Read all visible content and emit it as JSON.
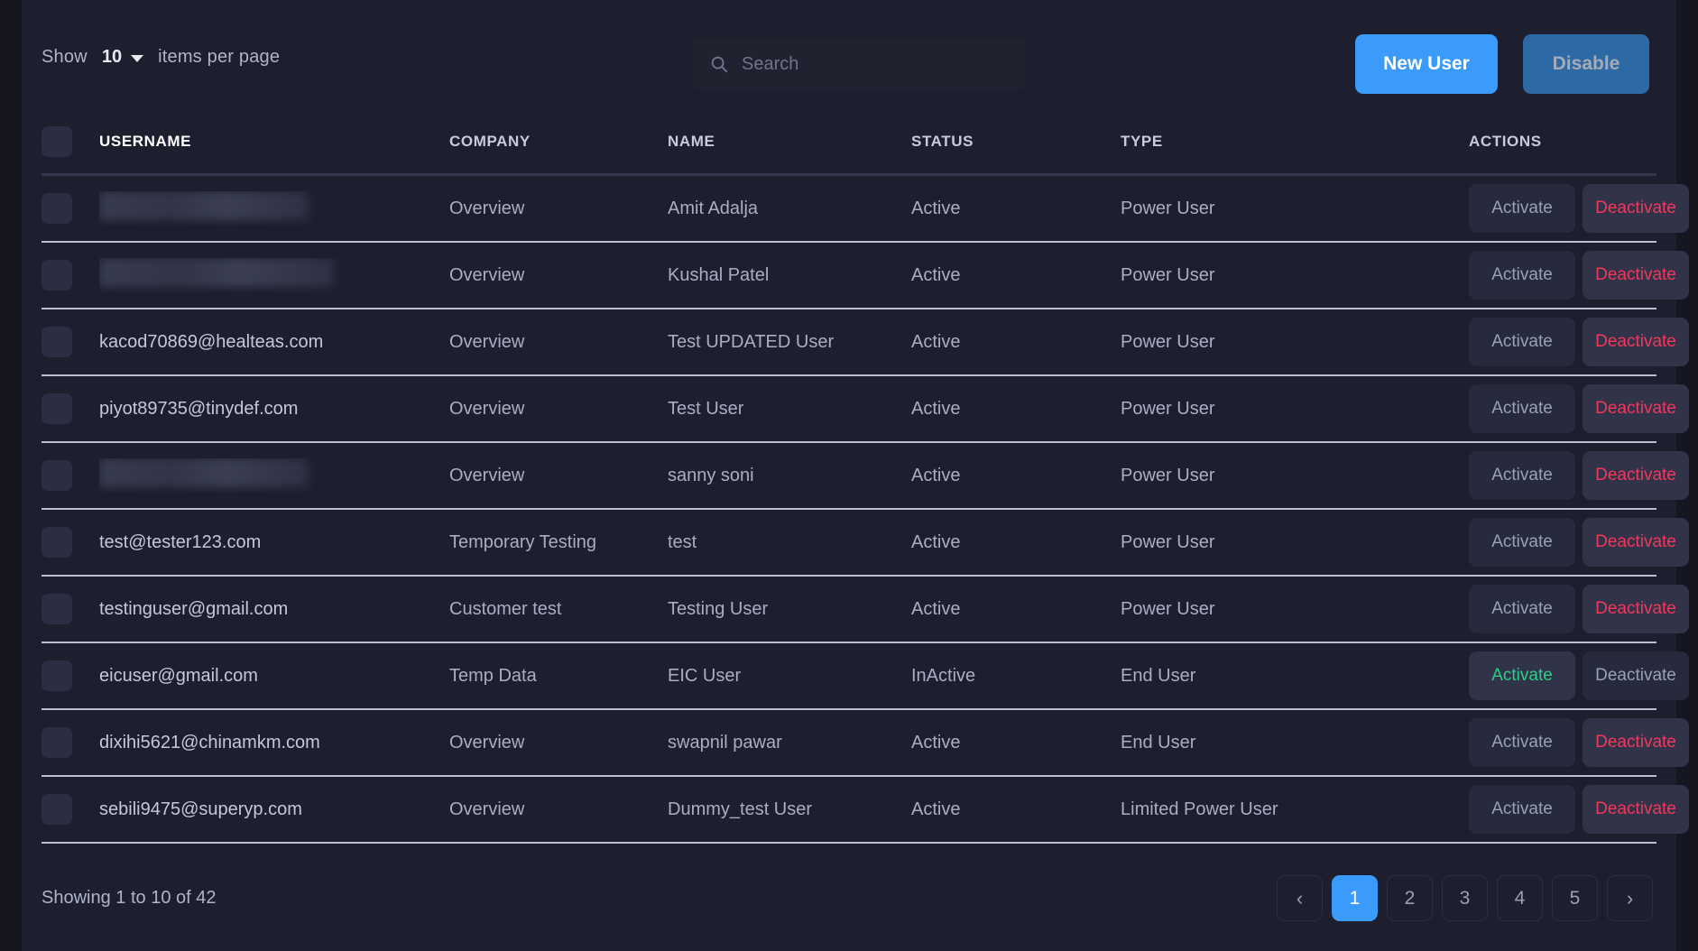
{
  "toolbar": {
    "show_label": "Show",
    "page_size_value": "10",
    "per_page_label": "items per page",
    "search_placeholder": "Search",
    "search_value": "",
    "new_user_label": "New User",
    "disable_label": "Disable",
    "accent_color": "#3b9bfa",
    "disable_color": "#2c69a5"
  },
  "table": {
    "columns": [
      "USERNAME",
      "COMPANY",
      "NAME",
      "STATUS",
      "TYPE",
      "ACTIONS"
    ],
    "activate_label": "Activate",
    "deactivate_label": "Deactivate",
    "danger_color": "#f5365c",
    "success_color": "#2dce89",
    "rows": [
      {
        "username": "",
        "redacted": true,
        "redacted_width": 232,
        "company": "Overview",
        "name": "Amit Adalja",
        "status": "Active",
        "type": "Power User",
        "active_state": true
      },
      {
        "username": "",
        "redacted": true,
        "redacted_width": 260,
        "company": "Overview",
        "name": "Kushal Patel",
        "status": "Active",
        "type": "Power User",
        "active_state": true
      },
      {
        "username": "kacod70869@healteas.com",
        "redacted": false,
        "company": "Overview",
        "name": "Test UPDATED User",
        "status": "Active",
        "type": "Power User",
        "active_state": true
      },
      {
        "username": "piyot89735@tinydef.com",
        "redacted": false,
        "company": "Overview",
        "name": "Test User",
        "status": "Active",
        "type": "Power User",
        "active_state": true
      },
      {
        "username": "",
        "redacted": true,
        "redacted_width": 232,
        "company": "Overview",
        "name": "sanny soni",
        "status": "Active",
        "type": "Power User",
        "active_state": true
      },
      {
        "username": "test@tester123.com",
        "redacted": false,
        "company": "Temporary Testing",
        "name": "test",
        "status": "Active",
        "type": "Power User",
        "active_state": true
      },
      {
        "username": "testinguser@gmail.com",
        "redacted": false,
        "company": "Customer test",
        "name": "Testing User",
        "status": "Active",
        "type": "Power User",
        "active_state": true
      },
      {
        "username": "eicuser@gmail.com",
        "redacted": false,
        "company": "Temp Data",
        "name": "EIC User",
        "status": "InActive",
        "type": "End User",
        "active_state": false
      },
      {
        "username": "dixihi5621@chinamkm.com",
        "redacted": false,
        "company": "Overview",
        "name": "swapnil pawar",
        "status": "Active",
        "type": "End User",
        "active_state": true
      },
      {
        "username": "sebili9475@superyp.com",
        "redacted": false,
        "company": "Overview",
        "name": "Dummy_test User",
        "status": "Active",
        "type": "Limited Power User",
        "active_state": true
      }
    ]
  },
  "footer": {
    "showing_text": "Showing 1 to 10 of 42",
    "prev_icon": "chevron-left-icon",
    "next_icon": "chevron-right-icon",
    "pages": [
      "1",
      "2",
      "3",
      "4",
      "5"
    ],
    "active_page": "1"
  }
}
